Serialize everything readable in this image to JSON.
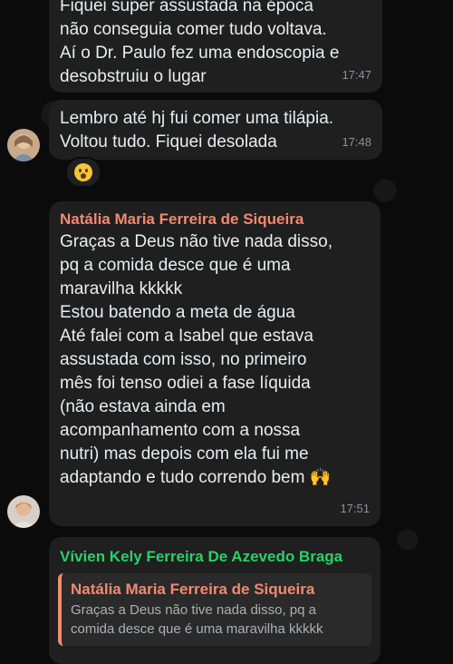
{
  "messages": [
    {
      "text": "Fiquei super assustada na época\nnão conseguia comer tudo voltava.\nAí o Dr. Paulo fez uma endoscopia e\ndesobstruiu o lugar",
      "time": "17:47"
    },
    {
      "text": "Lembro até hj fui comer uma tilápia.\nVoltou tudo. Fiquei desolada",
      "time": "17:48",
      "reaction_icon": "astonished-face-emoji"
    },
    {
      "sender": "Natália Maria Ferreira de Siqueira",
      "sender_color": "#f3896f",
      "text": "Graças a Deus não tive nada disso,\npq a comida desce que é uma\nmaravilha kkkkk\nEstou batendo a meta de água\nAté falei com a Isabel que estava\nassustada com isso, no primeiro\nmês foi tenso odiei a fase líquida\n(não estava ainda em\nacompanhamento com a nossa\nnutri) mas depois com ela fui me\nadaptando e tudo correndo bem 🙌",
      "time": "17:51"
    },
    {
      "sender": "Vívien Kely Ferreira De Azevedo Braga",
      "sender_color": "#25d366",
      "quoted_sender": "Natália Maria Ferreira de Siqueira",
      "quoted_sender_color": "#f3896f",
      "quoted_text": "Graças a Deus não tive nada disso, pq a comida desce que é uma maravilha kkkkk"
    }
  ]
}
